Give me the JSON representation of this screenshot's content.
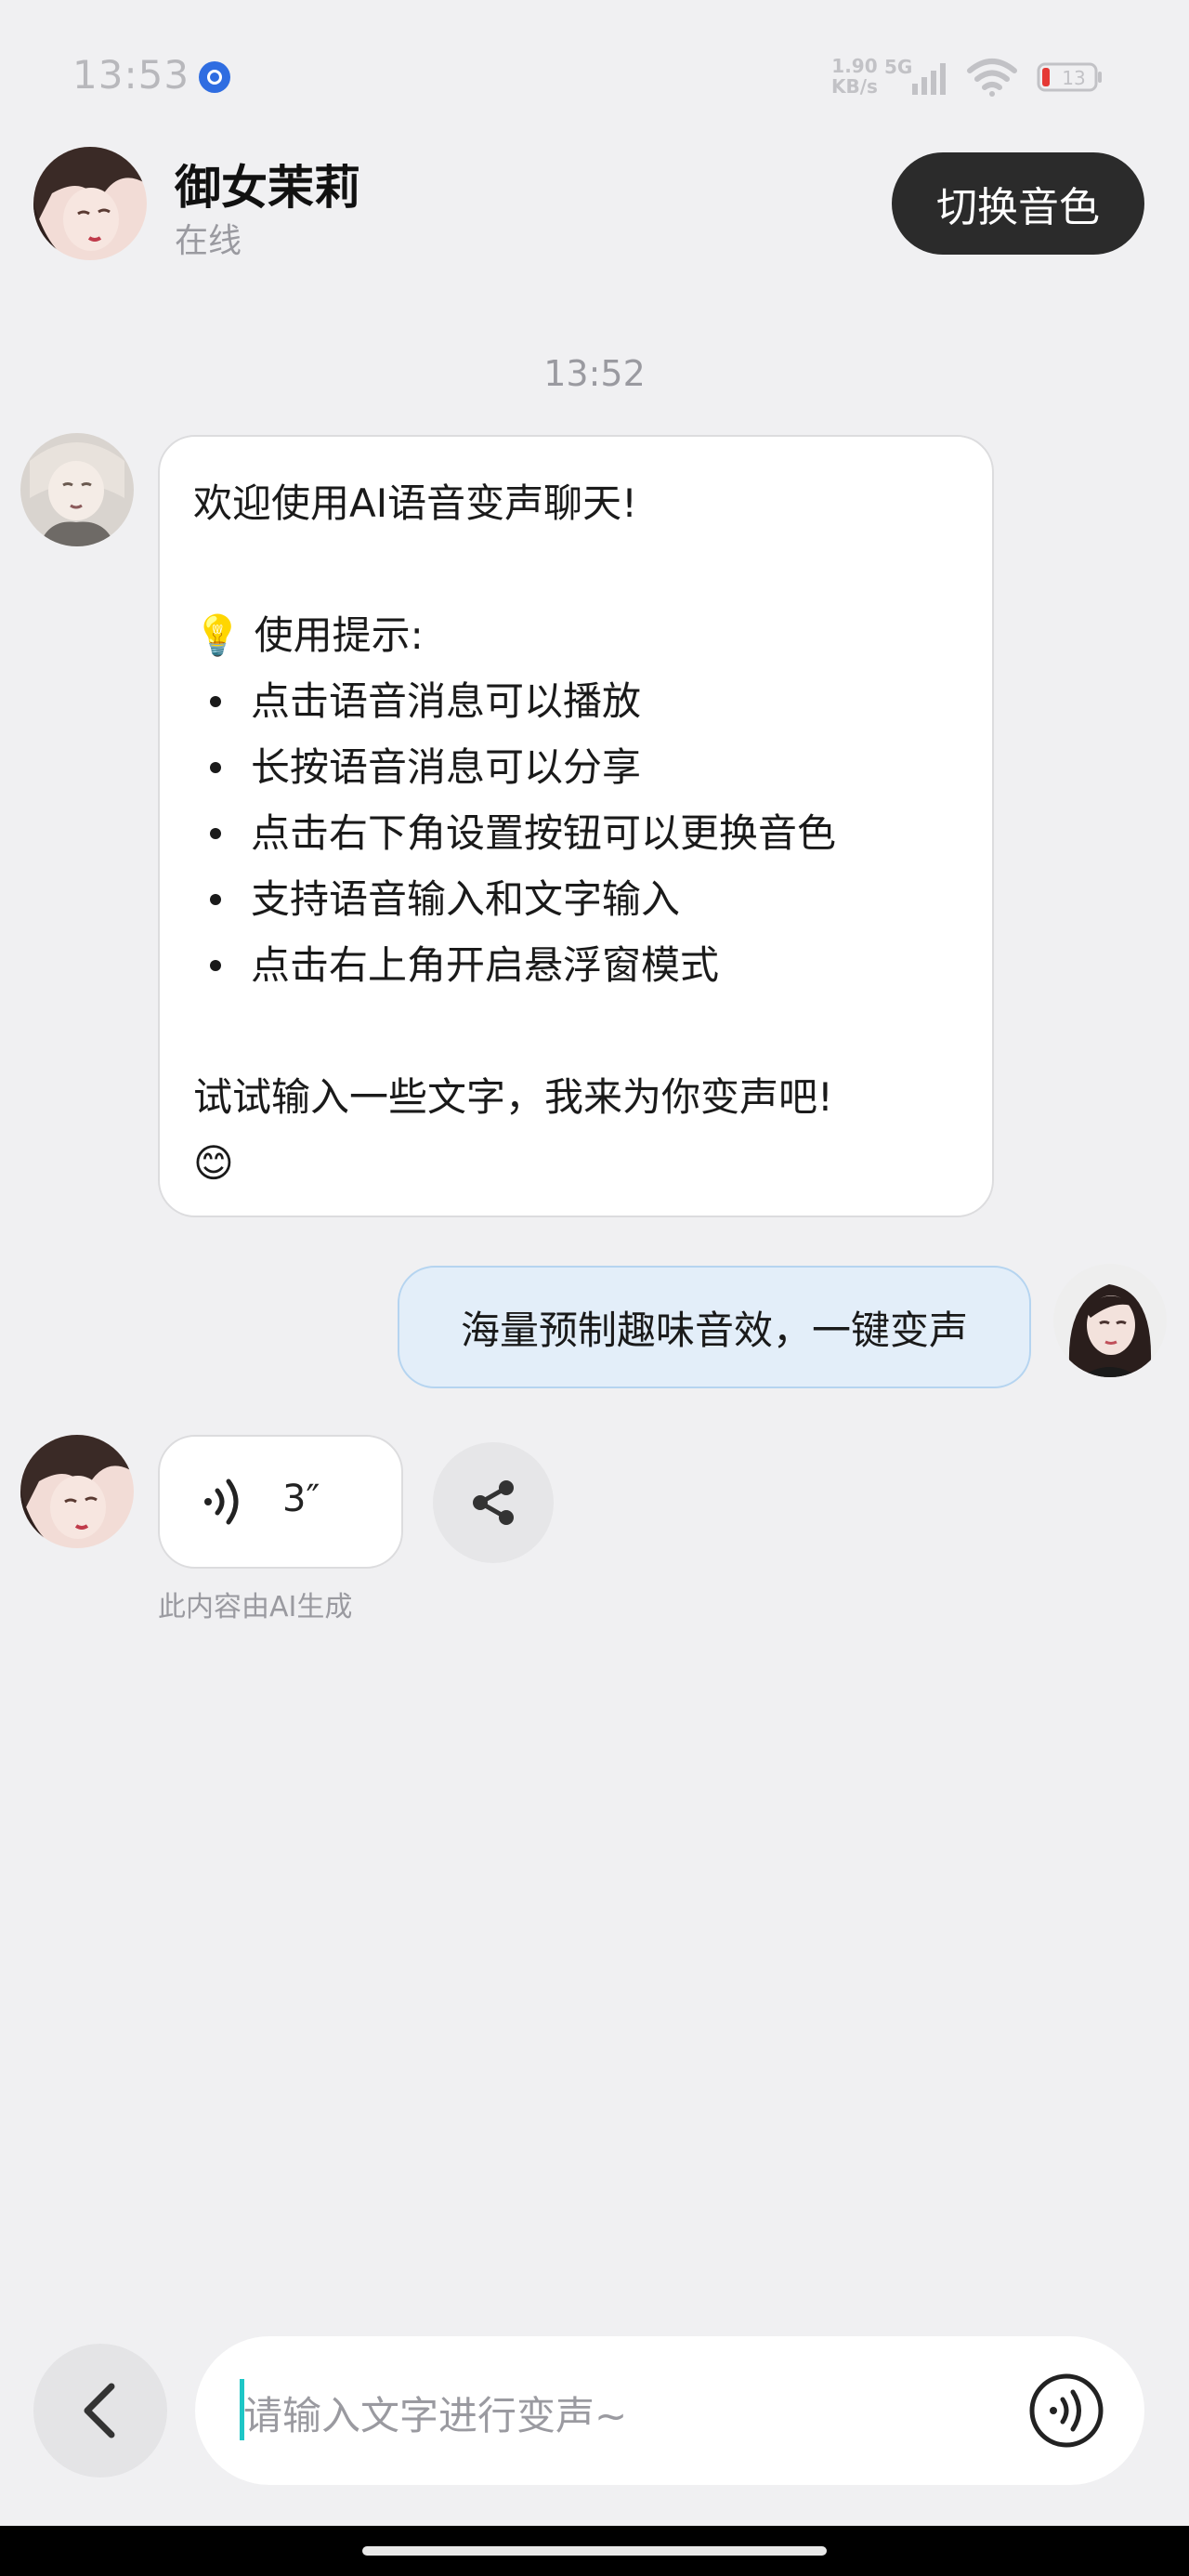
{
  "status_bar": {
    "time": "13:53",
    "net_speed_value": "1.90",
    "net_speed_unit": "KB/s",
    "net_type": "5G",
    "battery": "13"
  },
  "header": {
    "name": "御女茉莉",
    "status": "在线",
    "switch_voice_label": "切换音色"
  },
  "chat": {
    "timestamp": "13:52",
    "welcome": {
      "greeting": "欢迎使用AI语音变声聊天!",
      "tips_title": "💡 使用提示:",
      "tips": [
        "点击语音消息可以播放",
        "长按语音消息可以分享",
        "点击右下角设置按钮可以更换音色",
        "支持语音输入和文字输入",
        "点击右上角开启悬浮窗模式"
      ],
      "closing": "试试输入一些文字，我来为你变声吧!",
      "emoji": "😊"
    },
    "user_message": "海量预制趣味音效，一键变声",
    "voice_message": {
      "duration": "3″",
      "ai_note": "此内容由AI生成"
    }
  },
  "input": {
    "placeholder": "请输入文字进行变声~"
  },
  "colors": {
    "background": "#f0f0f2",
    "dark_button": "#2b2b2b",
    "user_bubble": "#e3eef9",
    "caret": "#1ec6c6"
  }
}
